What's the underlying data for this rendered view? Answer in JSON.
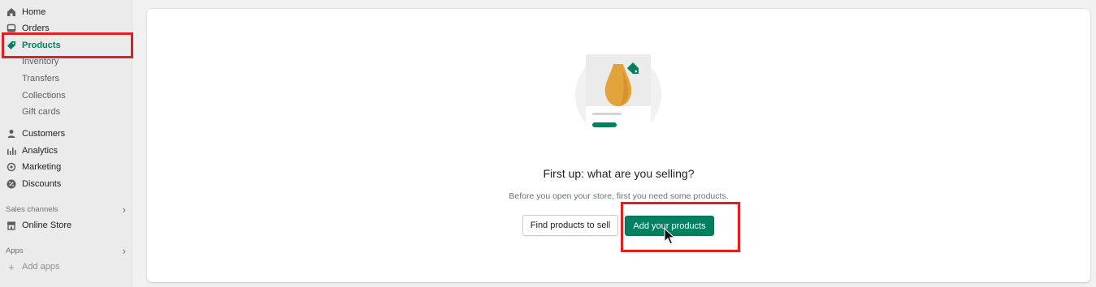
{
  "sidebar": {
    "items": [
      {
        "label": "Home",
        "icon": "home-icon"
      },
      {
        "label": "Orders",
        "icon": "orders-icon"
      },
      {
        "label": "Products",
        "icon": "tag-icon",
        "active": true
      },
      {
        "label": "Inventory"
      },
      {
        "label": "Transfers"
      },
      {
        "label": "Collections"
      },
      {
        "label": "Gift cards"
      },
      {
        "label": "Customers",
        "icon": "person-icon"
      },
      {
        "label": "Analytics",
        "icon": "bar-chart-icon"
      },
      {
        "label": "Marketing",
        "icon": "target-icon"
      },
      {
        "label": "Discounts",
        "icon": "discount-icon"
      }
    ],
    "sales_channels": {
      "heading": "Sales channels",
      "items": [
        {
          "label": "Online Store",
          "icon": "store-icon"
        }
      ]
    },
    "apps": {
      "heading": "Apps",
      "add_label": "Add apps"
    }
  },
  "main": {
    "heading": "First up: what are you selling?",
    "subtext": "Before you open your store, first you need some products.",
    "secondary_button": "Find products to sell",
    "primary_button": "Add your products"
  },
  "colors": {
    "accent": "#008060",
    "highlight": "#e02020",
    "vase": "#e3a33b"
  }
}
